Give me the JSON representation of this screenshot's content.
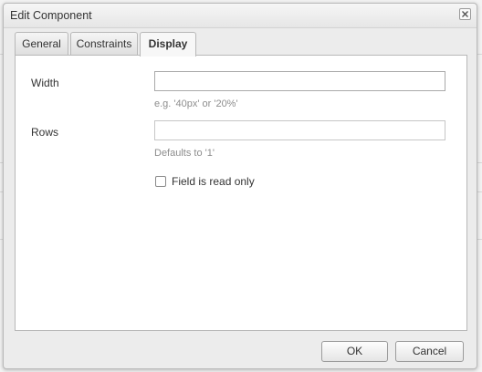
{
  "dialog": {
    "title": "Edit Component"
  },
  "tabs": [
    {
      "label": "General",
      "active": false
    },
    {
      "label": "Constraints",
      "active": false
    },
    {
      "label": "Display",
      "active": true
    }
  ],
  "form": {
    "width": {
      "label": "Width",
      "value": "",
      "hint": "e.g. '40px' or '20%'"
    },
    "rows": {
      "label": "Rows",
      "value": "",
      "hint": "Defaults to '1'"
    },
    "read_only": {
      "label": "Field is read only",
      "checked": false
    }
  },
  "buttons": {
    "ok": "OK",
    "cancel": "Cancel"
  },
  "icons": {
    "close": "close-icon"
  }
}
